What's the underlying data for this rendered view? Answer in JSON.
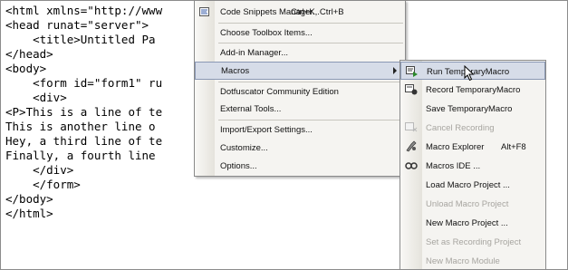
{
  "editor": {
    "lines": [
      "<html xmlns=\"http://www",
      "<head runat=\"server\">",
      "    <title>Untitled Pa",
      "</head>",
      "<body>",
      "    <form id=\"form1\" ru",
      "    <div>",
      "<P>This is a line of te",
      "This is another line o",
      "Hey, a third line of te",
      "Finally, a fourth line",
      "    </div>",
      "    </form>",
      "</body>",
      "</html>"
    ]
  },
  "tools_menu": {
    "items": [
      {
        "label": "Code Snippets Manager...",
        "shortcut": "Ctrl+K, Ctrl+B"
      },
      {
        "label": "Choose Toolbox Items..."
      },
      {
        "label": "Add-in Manager..."
      },
      {
        "label": "Macros"
      },
      {
        "label": "Dotfuscator Community Edition"
      },
      {
        "label": "External Tools..."
      },
      {
        "label": "Import/Export Settings..."
      },
      {
        "label": "Customize..."
      },
      {
        "label": "Options..."
      }
    ]
  },
  "macros_submenu": {
    "items": [
      {
        "label": "Run TemporaryMacro",
        "icon": "run-macro-icon"
      },
      {
        "label": "Record TemporaryMacro",
        "icon": "record-macro-icon"
      },
      {
        "label": "Save TemporaryMacro"
      },
      {
        "label": "Cancel Recording",
        "icon": "cancel-recording-icon"
      },
      {
        "label": "Macro Explorer",
        "shortcut": "Alt+F8",
        "icon": "macro-explorer-icon"
      },
      {
        "label": "Macros IDE ...",
        "icon": "macros-ide-icon"
      },
      {
        "label": "Load Macro Project ..."
      },
      {
        "label": "Unload Macro Project"
      },
      {
        "label": "New Macro Project ..."
      },
      {
        "label": "Set as Recording Project"
      },
      {
        "label": "New Macro Module"
      }
    ]
  },
  "colors": {
    "highlight": "#d6dce8",
    "highlight_border": "#8a98b4",
    "disabled_text": "#a7a5a0",
    "menu_bg": "#f5f4f1"
  }
}
